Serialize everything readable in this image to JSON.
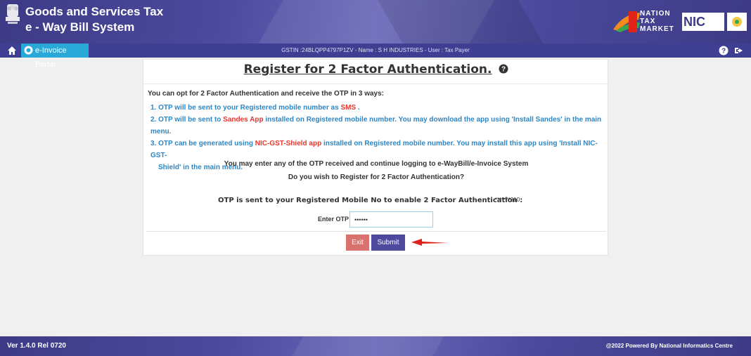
{
  "header": {
    "title_line1": "Goods and Services Tax",
    "title_line2": "e - Way Bill System",
    "logo_nt_1": "NATION",
    "logo_nt_2": "TAX",
    "logo_nt_3": "MARKET",
    "logo_nic": "NIC"
  },
  "navbar": {
    "portal_label": "e-Invoice Portal",
    "gstin_text": "GSTIN :24BLQPP4797P1ZV - Name : S H INDUSTRIES - User : Tax Payer"
  },
  "card": {
    "title": "Register for 2 Factor Authentication.",
    "intro": "You can opt for 2 Factor Authentication and receive the OTP in 3 ways:",
    "step1_pre": "1. OTP will be sent to your Registered mobile number as ",
    "step1_red": "SMS",
    "step1_post": " .",
    "step2_pre": "2. OTP will be sent to ",
    "step2_red": "Sandes App",
    "step2_post": " installed on Registered mobile number. You may download the app using 'Install Sandes' in the main menu.",
    "step3_pre": "3. OTP can be generated using ",
    "step3_red": "NIC-GST-Shield app",
    "step3_post": " installed on Registered mobile number. You may install this app using 'Install NIC-GST-",
    "step3_cont": "Shield' in the main menu.",
    "continue_text": "You may enter any of the OTP received and continue logging to e-WayBill/e-Invoice System",
    "question_text": "Do you wish to Register for 2 Factor Authentication?",
    "otp_sent_text": "OTP is sent to your Registered Mobile No to enable 2 Factor Authentication :",
    "masked_mobile": "*******310",
    "otp_label": "Enter OTP :",
    "otp_value": "••••••",
    "exit_label": "Exit",
    "submit_label": "Submit"
  },
  "footer": {
    "version": "Ver 1.4.0 Rel 0720",
    "powered": "@2022 Powered By National Informatics Centre"
  },
  "colors": {
    "header_bg": "#3d3a85",
    "link_blue": "#2d86c5",
    "highlight_red": "#e5382f",
    "exit_btn": "#d9726c",
    "submit_btn": "#4d4a9e",
    "arrow_red": "#e0201b"
  }
}
